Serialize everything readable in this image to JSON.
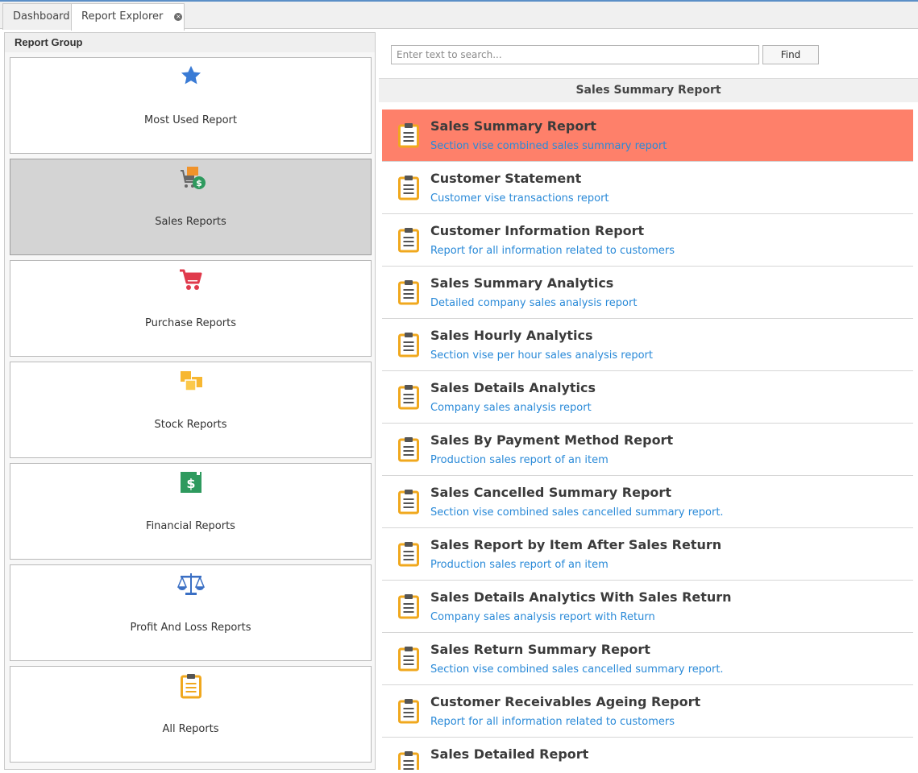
{
  "tabs": [
    {
      "label": "Dashboard"
    },
    {
      "label": "Report Explorer",
      "close_glyph": "×"
    }
  ],
  "report_group": {
    "header": "Report Group",
    "items": [
      {
        "label": "Most Used Report",
        "icon": "star-icon"
      },
      {
        "label": "Sales Reports",
        "icon": "sales-cart-dollar-icon",
        "selected": true
      },
      {
        "label": "Purchase Reports",
        "icon": "shopping-cart-icon"
      },
      {
        "label": "Stock Reports",
        "icon": "boxes-icon"
      },
      {
        "label": "Financial Reports",
        "icon": "dollar-book-icon"
      },
      {
        "label": "Profit And Loss Reports",
        "icon": "balance-scale-icon"
      },
      {
        "label": "All Reports",
        "icon": "clipboard-icon"
      }
    ]
  },
  "search": {
    "placeholder": "Enter text to search...",
    "value": "",
    "find_label": "Find"
  },
  "report_title": "Sales Summary Report",
  "reports": [
    {
      "title": "Sales Summary Report",
      "desc": "Section vise combined sales summary report",
      "selected": true
    },
    {
      "title": "Customer Statement",
      "desc": "Customer vise transactions report"
    },
    {
      "title": "Customer Information Report",
      "desc": "Report for all information related to customers"
    },
    {
      "title": "Sales Summary Analytics",
      "desc": "Detailed company sales analysis report"
    },
    {
      "title": "Sales Hourly Analytics",
      "desc": "Section vise per hour sales analysis report"
    },
    {
      "title": "Sales Details Analytics",
      "desc": "Company sales analysis report"
    },
    {
      "title": "Sales By Payment Method Report",
      "desc": "Production sales report of an item"
    },
    {
      "title": "Sales Cancelled Summary Report",
      "desc": "Section vise combined sales cancelled summary report."
    },
    {
      "title": "Sales Report by Item After Sales Return",
      "desc": "Production sales report of an item"
    },
    {
      "title": "Sales Details Analytics With Sales Return",
      "desc": "Company sales analysis report with Return"
    },
    {
      "title": "Sales Return Summary Report",
      "desc": "Section vise combined sales cancelled summary report."
    },
    {
      "title": "Customer Receivables Ageing Report",
      "desc": "Report for all information related to customers"
    },
    {
      "title": "Sales Detailed Report",
      "desc": ""
    }
  ],
  "colors": {
    "selected_report_bg": "#fe806a",
    "selected_group_bg": "#d4d4d4",
    "description_text": "#2a8ad8",
    "clipboard_icon": "#f0a81e",
    "star_icon": "#3a7bd5",
    "cart_icon": "#e03a4c",
    "dollar_icon": "#2e9a5e"
  }
}
